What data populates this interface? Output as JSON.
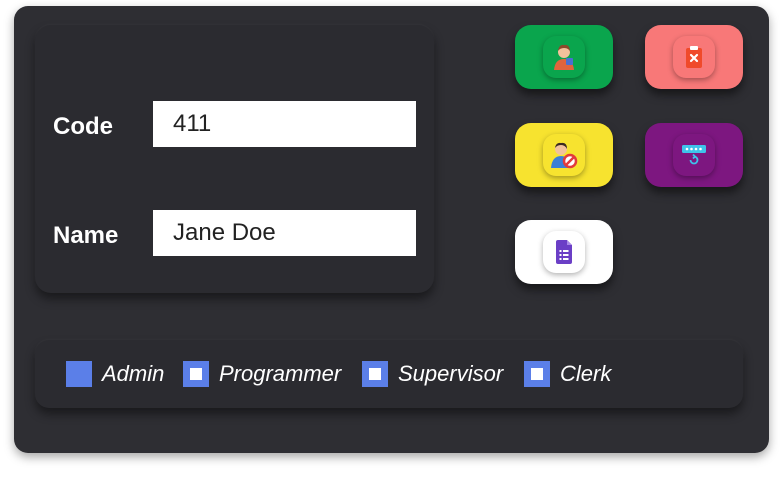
{
  "form": {
    "code_label": "Code",
    "code_value": "411",
    "name_label": "Name",
    "name_value": "Jane Doe"
  },
  "actions": [
    {
      "name": "add-user",
      "icon": "user-plus-icon",
      "color": "#0aa54d"
    },
    {
      "name": "delete",
      "icon": "clipboard-delete-icon",
      "color": "#f87878"
    },
    {
      "name": "block-user",
      "icon": "user-block-icon",
      "color": "#f7e32f"
    },
    {
      "name": "reset-password",
      "icon": "password-reset-icon",
      "color": "#7d1780"
    },
    {
      "name": "list",
      "icon": "document-list-icon",
      "color": "#ffffff"
    }
  ],
  "roles": [
    {
      "label": "Admin",
      "checked": true
    },
    {
      "label": "Programmer",
      "checked": false
    },
    {
      "label": "Supervisor",
      "checked": false
    },
    {
      "label": "Clerk",
      "checked": false
    }
  ],
  "colors": {
    "window_bg": "#2e2e33",
    "checkbox_accent": "#5b7fe8"
  }
}
